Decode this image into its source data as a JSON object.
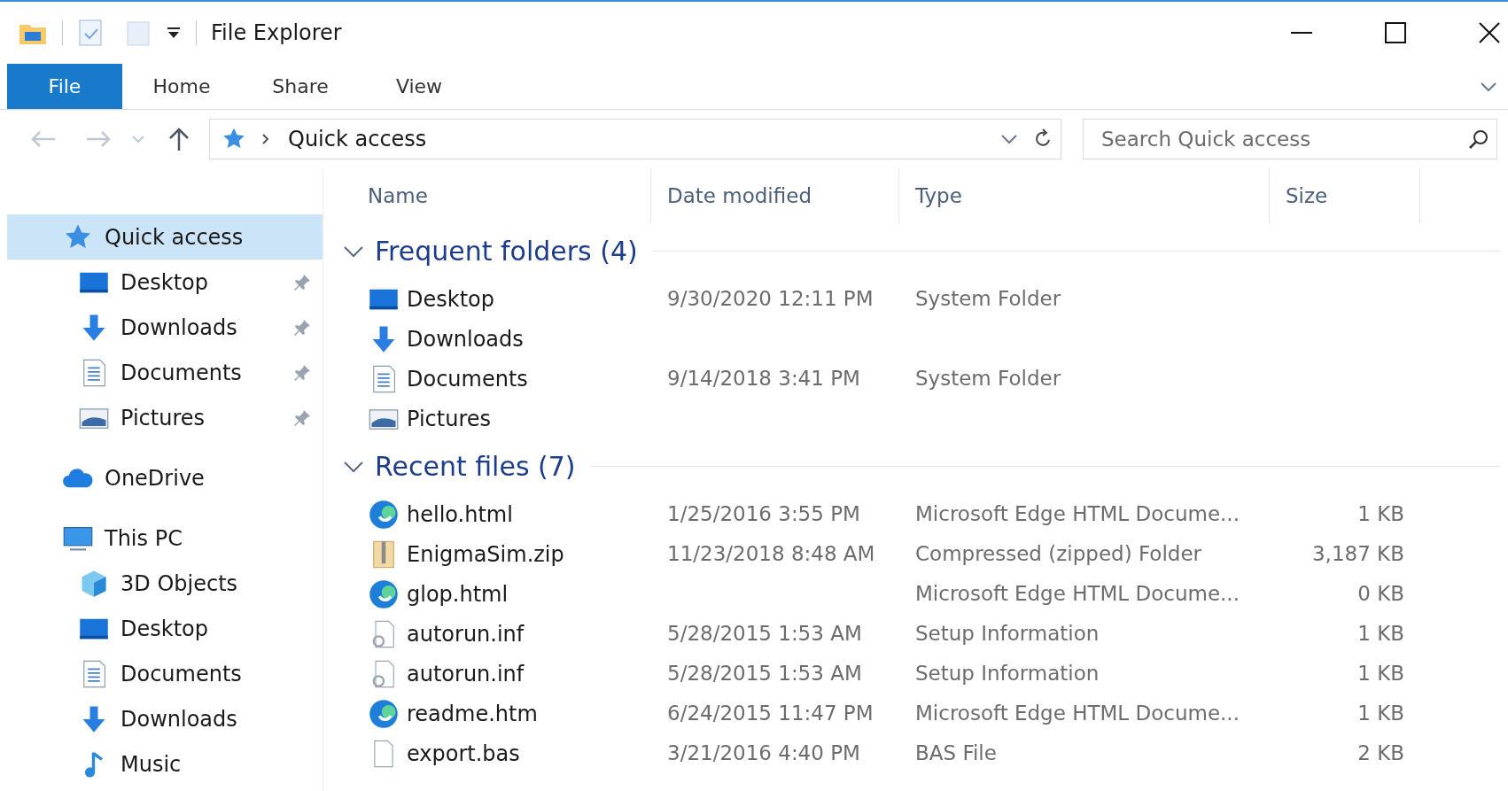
{
  "window": {
    "title": "File Explorer"
  },
  "ribbon_tabs": [
    {
      "label": "File",
      "selected": true
    },
    {
      "label": "Home",
      "selected": false
    },
    {
      "label": "Share",
      "selected": false
    },
    {
      "label": "View",
      "selected": false
    }
  ],
  "address": {
    "path": "Quick access"
  },
  "search": {
    "placeholder": "Search Quick access"
  },
  "sidebar": {
    "items": [
      {
        "label": "Quick access",
        "kind": "star",
        "selected": true,
        "children": [
          {
            "label": "Desktop",
            "kind": "desktop",
            "pinned": true,
            "selected": false
          },
          {
            "label": "Downloads",
            "kind": "downloads",
            "pinned": true,
            "selected": false
          },
          {
            "label": "Documents",
            "kind": "documents",
            "pinned": true,
            "selected": false
          },
          {
            "label": "Pictures",
            "kind": "pictures",
            "pinned": true,
            "selected": false
          }
        ]
      },
      {
        "label": "OneDrive",
        "kind": "cloud",
        "selected": false
      },
      {
        "label": "This PC",
        "kind": "pc",
        "selected": false,
        "children": [
          {
            "label": "3D Objects",
            "kind": "cube",
            "pinned": false,
            "selected": false
          },
          {
            "label": "Desktop",
            "kind": "desktop",
            "pinned": false,
            "selected": false
          },
          {
            "label": "Documents",
            "kind": "documents",
            "pinned": false,
            "selected": false
          },
          {
            "label": "Downloads",
            "kind": "downloads",
            "pinned": false,
            "selected": false
          },
          {
            "label": "Music",
            "kind": "music",
            "pinned": false,
            "selected": false
          }
        ]
      }
    ]
  },
  "table": {
    "columns": [
      "Name",
      "Date modified",
      "Type",
      "Size"
    ],
    "groups": [
      {
        "title": "Frequent folders (4)",
        "expanded": true,
        "rows": [
          {
            "name": "Desktop",
            "kind": "desktop",
            "date": "9/30/2020 12:11 PM",
            "type": "System Folder"
          },
          {
            "name": "Downloads",
            "kind": "downloads"
          },
          {
            "name": "Documents",
            "kind": "documents",
            "date": "9/14/2018 3:41 PM",
            "type": "System Folder"
          },
          {
            "name": "Pictures",
            "kind": "pictures"
          }
        ]
      },
      {
        "title": "Recent files (7)",
        "expanded": true,
        "rows": [
          {
            "name": "hello.html",
            "kind": "edge",
            "date": "1/25/2016 3:55 PM",
            "type": "Microsoft Edge HTML Docume...",
            "size": "1 KB"
          },
          {
            "name": "EnigmaSim.zip",
            "kind": "zip",
            "date": "11/23/2018 8:48 AM",
            "type": "Compressed (zipped) Folder",
            "size": "3,187 KB"
          },
          {
            "name": "glop.html",
            "kind": "edge",
            "type": "Microsoft Edge HTML Docume...",
            "size": "0 KB"
          },
          {
            "name": "autorun.inf",
            "kind": "setup",
            "date": "5/28/2015 1:53 AM",
            "type": "Setup Information",
            "size": "1 KB"
          },
          {
            "name": "autorun.inf",
            "kind": "setup",
            "date": "5/28/2015 1:53 AM",
            "type": "Setup Information",
            "size": "1 KB"
          },
          {
            "name": "readme.htm",
            "kind": "edge",
            "date": "6/24/2015 11:47 PM",
            "type": "Microsoft Edge HTML Docume...",
            "size": "1 KB"
          },
          {
            "name": "export.bas",
            "kind": "file",
            "date": "3/21/2016 4:40 PM",
            "type": "BAS File",
            "size": "2 KB"
          }
        ]
      }
    ]
  }
}
